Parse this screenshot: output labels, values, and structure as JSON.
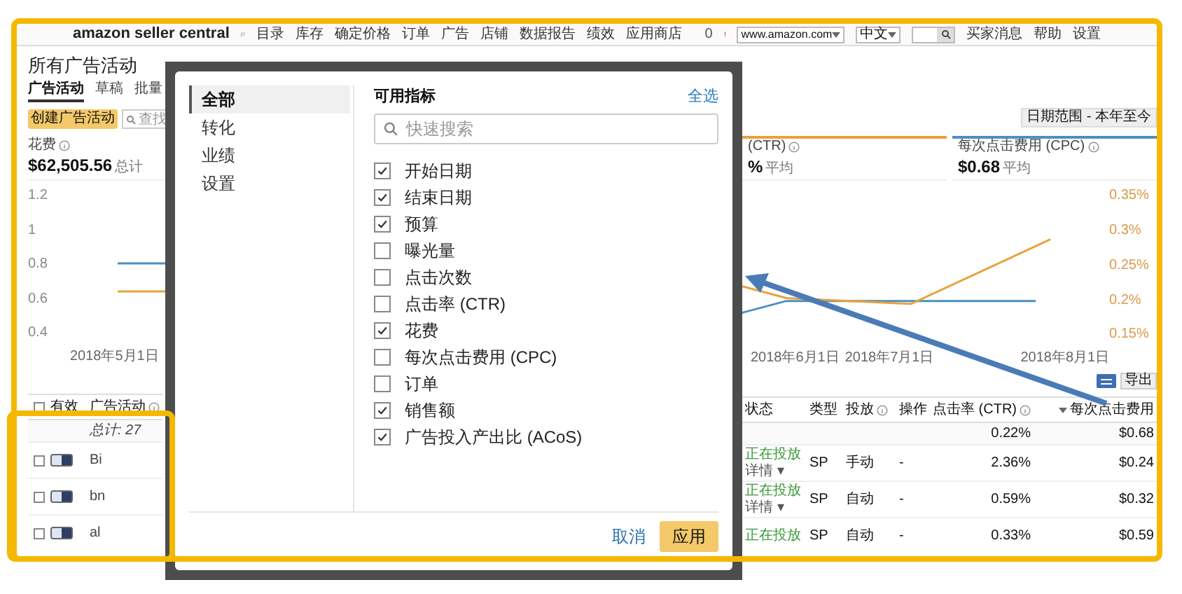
{
  "top_nav": {
    "logo": "amazon seller central",
    "items": [
      "目录",
      "库存",
      "确定价格",
      "订单",
      "广告",
      "店铺",
      "数据报告",
      "绩效",
      "应用商店"
    ],
    "notifications": "0",
    "marketplace": "www.amazon.com",
    "language": "中文",
    "links": [
      "买家消息",
      "帮助",
      "设置"
    ]
  },
  "page": {
    "title": "所有广告活动",
    "tabs": [
      {
        "label": "广告活动",
        "selected": true
      },
      {
        "label": "草稿",
        "selected": false
      },
      {
        "label": "批量",
        "selected": false
      }
    ],
    "create_button": "创建广告活动",
    "search": {
      "placeholder": "查找"
    },
    "date_range": "日期范围 - 本年至今"
  },
  "spend": {
    "label": "花费",
    "value": "$62,505.56",
    "note": "总计"
  },
  "metrics_right": [
    {
      "label": "(CTR)",
      "value": "%",
      "note": "平均",
      "color": "#e8a23a"
    },
    {
      "label": "每次点击费用 (CPC)",
      "value": "$0.68",
      "note": "平均",
      "color": "#4a90c2"
    }
  ],
  "chart": {
    "left_ticks": [
      "1.2",
      "1",
      "0.8",
      "0.6",
      "0.4"
    ],
    "right_ticks": [
      "0.35%",
      "0.3%",
      "0.25%",
      "0.2%",
      "0.15%"
    ],
    "x_labels": [
      "2018年5月1日",
      "2018年6月1日",
      "2018年7月1日",
      "2018年8月1日"
    ]
  },
  "export_button": "导出",
  "table": {
    "header_checked": false,
    "columns_left": [
      "有效",
      "广告活动"
    ],
    "columns_right": [
      "状态",
      "类型",
      "投放",
      "操作",
      "点击率 (CTR)",
      "每次点击费用"
    ],
    "total": {
      "label": "总计: 27",
      "ctr": "0.22%",
      "cpc": "$0.68"
    },
    "rows": [
      {
        "name": "Bi",
        "selected": false,
        "enabled": true,
        "status": "正在投放",
        "detail": "详情 ▾",
        "type": "SP",
        "targeting": "手动",
        "action": "-",
        "ctr": "2.36%",
        "cpc": "$0.24"
      },
      {
        "name": "bn",
        "selected": false,
        "enabled": true,
        "status": "正在投放",
        "detail": "详情 ▾",
        "type": "SP",
        "targeting": "自动",
        "action": "-",
        "ctr": "0.59%",
        "cpc": "$0.32"
      },
      {
        "name": "al",
        "selected": false,
        "enabled": true,
        "status": "正在投放",
        "type": "SP",
        "targeting": "自动",
        "action": "-",
        "ctr": "0.33%",
        "cpc": "$0.59"
      }
    ]
  },
  "modal": {
    "categories": [
      {
        "label": "全部",
        "selected": true
      },
      {
        "label": "转化",
        "selected": false
      },
      {
        "label": "业绩",
        "selected": false
      },
      {
        "label": "设置",
        "selected": false
      }
    ],
    "title": "可用指标",
    "select_all": "全选",
    "search": {
      "placeholder": "快速搜索"
    },
    "metrics": [
      {
        "label": "开始日期",
        "checked": true
      },
      {
        "label": "结束日期",
        "checked": true
      },
      {
        "label": "预算",
        "checked": true
      },
      {
        "label": "曝光量",
        "checked": false
      },
      {
        "label": "点击次数",
        "checked": false
      },
      {
        "label": "点击率 (CTR)",
        "checked": false
      },
      {
        "label": "花费",
        "checked": true
      },
      {
        "label": "每次点击费用 (CPC)",
        "checked": false
      },
      {
        "label": "订单",
        "checked": false
      },
      {
        "label": "销售额",
        "checked": true
      },
      {
        "label": "广告投入产出比 (ACoS)",
        "checked": true
      }
    ],
    "cancel": "取消",
    "apply": "应用"
  }
}
